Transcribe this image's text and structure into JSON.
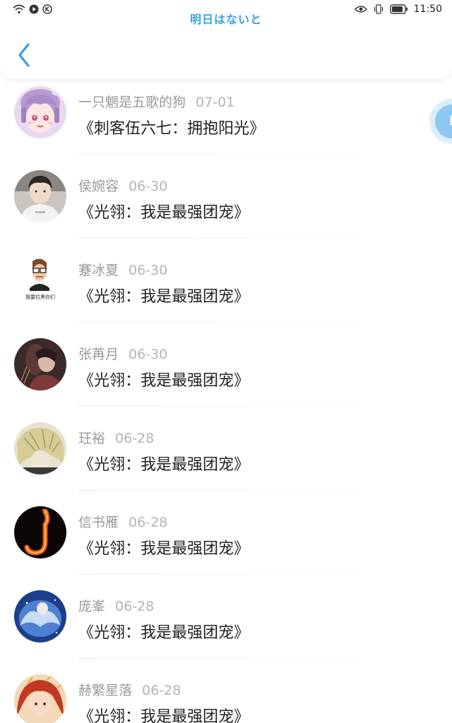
{
  "status": {
    "time": "11:50"
  },
  "header": {
    "title": "明日はないと"
  },
  "float_button": {
    "letter": "K"
  },
  "comments": [
    {
      "user": "一只魍是五歌的狗",
      "date": "07-01",
      "book": "《刺客伍六七：拥抱阳光》"
    },
    {
      "user": "侯婉容",
      "date": "06-30",
      "book": "《光翎：我是最强团宠》"
    },
    {
      "user": "蹇冰夏",
      "date": "06-30",
      "book": "《光翎：我是最强团宠》",
      "avatar_caption": "我要拉黑你们"
    },
    {
      "user": "张苒月",
      "date": "06-30",
      "book": "《光翎：我是最强团宠》"
    },
    {
      "user": "玨裕",
      "date": "06-28",
      "book": "《光翎：我是最强团宠》"
    },
    {
      "user": "信书雁",
      "date": "06-28",
      "book": "《光翎：我是最强团宠》"
    },
    {
      "user": "庞峯",
      "date": "06-28",
      "book": "《光翎：我是最强团宠》"
    },
    {
      "user": "赫繁星落",
      "date": "06-28",
      "book": "《光翎：我是最强团宠》"
    }
  ],
  "colors": {
    "accent": "#3a9fe0",
    "text_primary": "#222222",
    "text_secondary": "#9a9a9a"
  }
}
